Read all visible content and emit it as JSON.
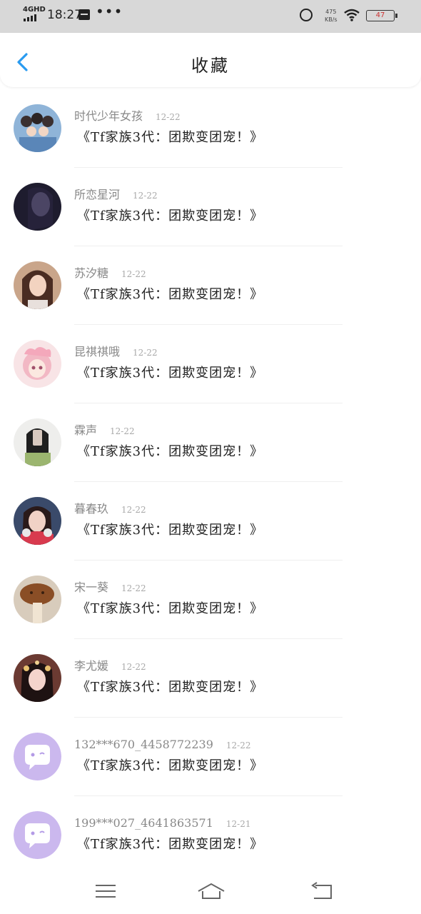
{
  "status_bar": {
    "network": "4GHD",
    "time": "18:27",
    "more": "•••",
    "speed_top": "475",
    "speed_unit": "KB/s",
    "battery": "47"
  },
  "header": {
    "title": "收藏",
    "back_icon": "chevron-left-icon",
    "accent_color": "#2a9bf0"
  },
  "items": [
    {
      "name": "时代少年女孩",
      "date": "12-22",
      "title": "《Tf家族3代：团欺变团宠！》",
      "avatar": "group-photo"
    },
    {
      "name": "所恋星河",
      "date": "12-22",
      "title": "《Tf家族3代：团欺变团宠！》",
      "avatar": "dark-portrait"
    },
    {
      "name": "苏汐糖",
      "date": "12-22",
      "title": "《Tf家族3代：团欺变团宠！》",
      "avatar": "girl-portrait"
    },
    {
      "name": "昆祺祺哦",
      "date": "12-22",
      "title": "《Tf家族3代：团欺变团宠！》",
      "avatar": "anime-girl"
    },
    {
      "name": "霖声",
      "date": "12-22",
      "title": "《Tf家族3代：团欺变团宠！》",
      "avatar": "girl-phone"
    },
    {
      "name": "暮春玖",
      "date": "12-22",
      "title": "《Tf家族3代：团欺变团宠！》",
      "avatar": "girl-headphones"
    },
    {
      "name": "宋一葵",
      "date": "12-22",
      "title": "《Tf家族3代：团欺变团宠！》",
      "avatar": "bread-photo"
    },
    {
      "name": "李尤媛",
      "date": "12-22",
      "title": "《Tf家族3代：团欺变团宠！》",
      "avatar": "costume-girl"
    },
    {
      "name": "132***670_4458772239",
      "date": "12-22",
      "title": "《Tf家族3代：团欺变团宠！》",
      "avatar": "default-chat"
    },
    {
      "name": "199***027_4641863571",
      "date": "12-21",
      "title": "《Tf家族3代：团欺变团宠！》",
      "avatar": "default-chat"
    }
  ],
  "nav_bar": {
    "menu_icon": "menu-icon",
    "home_icon": "home-icon",
    "back_icon": "return-icon"
  }
}
